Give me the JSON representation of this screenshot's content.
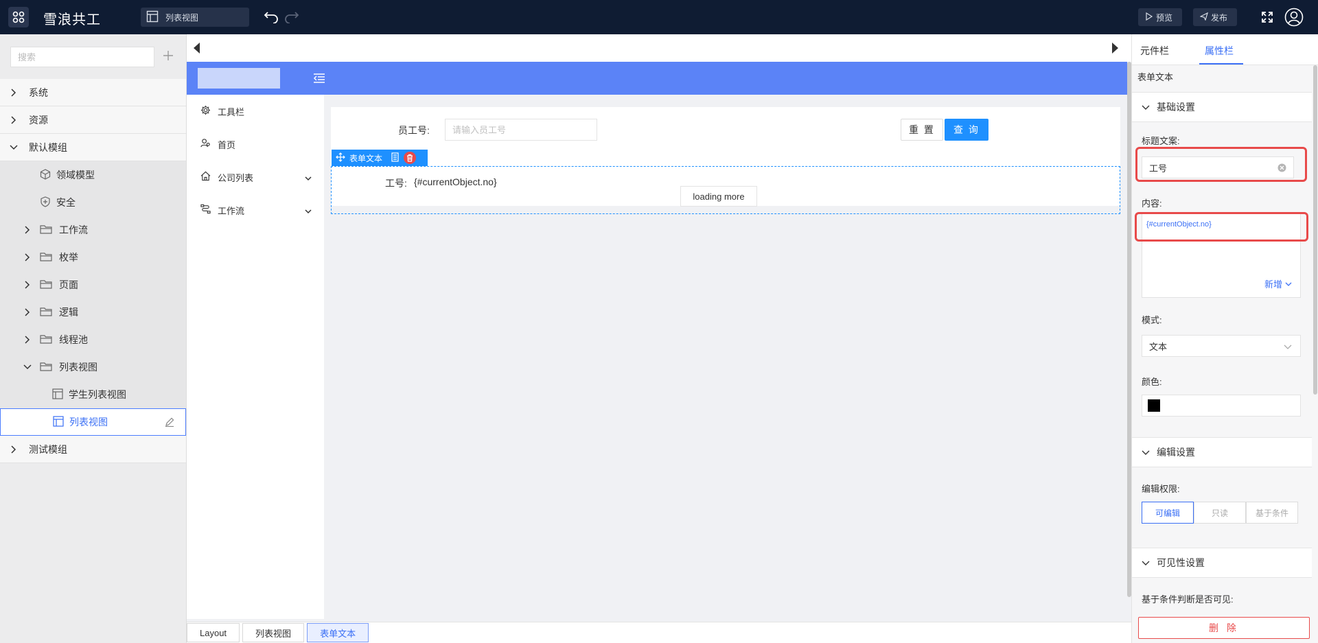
{
  "header": {
    "title": "雪浪共工",
    "tab_label": "列表视图",
    "preview_label": "预览",
    "publish_label": "发布"
  },
  "sidebar": {
    "search_placeholder": "搜索",
    "groups": [
      {
        "label": "系统",
        "expanded": false
      },
      {
        "label": "资源",
        "expanded": false
      },
      {
        "label": "默认模组",
        "expanded": true
      }
    ],
    "default_children": [
      {
        "label": "领域模型",
        "icon": "cube-icon",
        "expandable": false
      },
      {
        "label": "安全",
        "icon": "shield-icon",
        "expandable": false
      },
      {
        "label": "工作流",
        "icon": "folder-icon",
        "expandable": true
      },
      {
        "label": "枚举",
        "icon": "folder-icon",
        "expandable": true
      },
      {
        "label": "页面",
        "icon": "folder-icon",
        "expandable": true
      },
      {
        "label": "逻辑",
        "icon": "folder-icon",
        "expandable": true
      },
      {
        "label": "线程池",
        "icon": "folder-icon",
        "expandable": true
      },
      {
        "label": "列表视图",
        "icon": "folder-icon",
        "expandable": true,
        "expanded": true
      }
    ],
    "list_view_children": [
      {
        "label": "学生列表视图",
        "selected": false
      },
      {
        "label": "列表视图",
        "selected": true
      }
    ],
    "last_group": {
      "label": "测试模组"
    }
  },
  "canvas": {
    "menu": [
      {
        "label": "工具栏",
        "icon": "gear-icon",
        "has_caret": false
      },
      {
        "label": "首页",
        "icon": "user-group-icon",
        "has_caret": false
      },
      {
        "label": "公司列表",
        "icon": "home-icon",
        "has_caret": true
      },
      {
        "label": "工作流",
        "icon": "flow-icon",
        "has_caret": true
      }
    ],
    "form": {
      "label": "员工号:",
      "placeholder": "请输入员工号",
      "reset_label": "重 置",
      "query_label": "查 询"
    },
    "selection": {
      "toolbar_label": "表单文本",
      "field_label": "工号:",
      "field_value": "{#currentObject.no}",
      "loading_label": "loading more"
    },
    "breadcrumb": [
      "Layout",
      "列表视图",
      "表单文本"
    ]
  },
  "panel": {
    "tabs": [
      "元件栏",
      "属性栏"
    ],
    "active_tab": 1,
    "title": "表单文本",
    "basic_section": "基础设置",
    "title_text_label": "标题文案:",
    "title_text_value": "工号",
    "content_label": "内容:",
    "content_value": "{#currentObject.no}",
    "add_label": "新增",
    "mode_label": "模式:",
    "mode_value": "文本",
    "color_label": "颜色:",
    "color_value": "#000000",
    "edit_section": "编辑设置",
    "edit_perm_label": "编辑权限:",
    "edit_perm_options": [
      "可编辑",
      "只读",
      "基于条件"
    ],
    "edit_perm_selected": 0,
    "visibility_section": "可见性设置",
    "visibility_label": "基于条件判断是否可见:",
    "delete_label": "删 除"
  },
  "colors": {
    "topbar": "#0f1c33",
    "accent": "#3a6ff5",
    "app_header": "#5b83f7",
    "primary_button": "#1e90ff",
    "danger": "#e84a4a"
  }
}
